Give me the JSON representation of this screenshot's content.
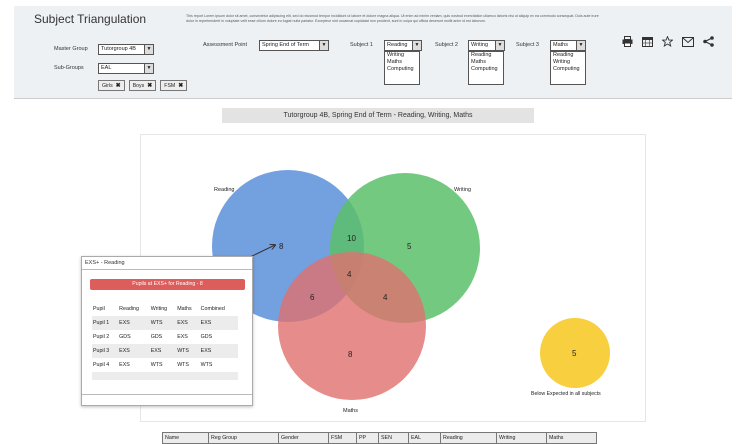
{
  "header": {
    "title": "Subject Triangulation",
    "description": "This report Lorem ipsum dolor sit amet, consectetur adipiscing elit, sed do eiusmod tempor incididunt ut labore et dolore magna aliqua. Ut enim ad minim veniam, quis nostrud exercitation ullamco laboris nisi ut aliquip ex ea commodo consequat. Duis aute irure dolor in reprehenderit in voluptate velit esse cillum dolore eu fugiat nulla pariatur. Excepteur sint occaecat cupidatat non proident, sunt in culpa qui officia deserunt mollit anim id est laborum."
  },
  "filters": {
    "master_group_label": "Master Group",
    "master_group_value": "Tutorgroup 4B",
    "sub_groups_label": "Sub-Groups",
    "sub_groups_value": "EAL",
    "chips": [
      "Girls",
      "Boys",
      "FSM"
    ],
    "assessment_label": "Assessment Point",
    "assessment_value": "Spring End of Term",
    "subject1_label": "Subject 1",
    "subject1_value": "Reading",
    "subject1_options": [
      "Writing",
      "Maths",
      "Computing"
    ],
    "subject2_label": "Subject 2",
    "subject2_value": "Writing",
    "subject2_options": [
      "Reading",
      "Maths",
      "Computing"
    ],
    "subject3_label": "Subject 3",
    "subject3_value": "Maths",
    "subject3_options": [
      "Reading",
      "Writing",
      "Computing"
    ]
  },
  "toolbar_icons": [
    "print-icon",
    "calendar-icon",
    "star-icon",
    "mail-icon",
    "share-icon"
  ],
  "caption": "Tutorgroup 4B, Spring End of Term - Reading, Writing, Maths",
  "venn": {
    "reading_label": "Reading",
    "writing_label": "Writing",
    "maths_label": "Maths",
    "reading_only": "8",
    "writing_only": "5",
    "maths_only": "8",
    "reading_writing": "10",
    "reading_maths": "6",
    "writing_maths": "4",
    "all_three": "4",
    "below_expected": "5",
    "below_expected_label": "Below Expected in all subjects",
    "colors": {
      "reading": "#5b8fd9",
      "writing": "#5cbf6a",
      "maths": "#e0716e",
      "below": "#f7cf3f"
    }
  },
  "popup": {
    "title": "EXS+ - Reading",
    "banner": "Pupils at EXS+ for Reading - 8",
    "columns": [
      "Pupil",
      "Reading",
      "Writing",
      "Maths",
      "Combined"
    ],
    "rows": [
      [
        "Pupil 1",
        "EXS",
        "WTS",
        "EXS",
        "EXS"
      ],
      [
        "Pupil 2",
        "GDS",
        "GDS",
        "EXS",
        "GDS"
      ],
      [
        "Pupil 3",
        "EXS",
        "EXS",
        "WTS",
        "EXS"
      ],
      [
        "Pupil 4",
        "EXS",
        "WTS",
        "WTS",
        "WTS"
      ]
    ]
  },
  "bottom_table": {
    "columns": [
      "Name",
      "Reg Group",
      "Gender",
      "FSM",
      "PP",
      "SEN",
      "EAL",
      "Reading",
      "Writing",
      "Maths"
    ]
  }
}
